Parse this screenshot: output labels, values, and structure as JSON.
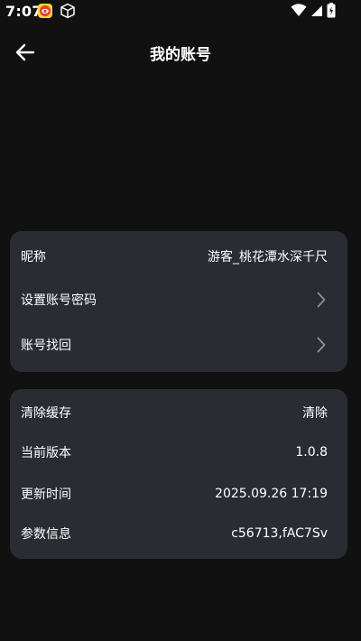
{
  "status_bar": {
    "time": "7:07"
  },
  "header": {
    "title": "我的账号"
  },
  "account_card": {
    "nickname_label": "昵称",
    "nickname_value": "游客_桃花潭水深千尺",
    "set_password_label": "设置账号密码",
    "recover_account_label": "账号找回"
  },
  "info_card": {
    "clear_cache_label": "清除缓存",
    "clear_cache_action": "清除",
    "version_label": "当前版本",
    "version_value": "1.0.8",
    "update_time_label": "更新时间",
    "update_time_value": "2025.09.26 17:19",
    "params_label": "参数信息",
    "params_value": "c56713,fAC7Sv"
  },
  "colors": {
    "background": "#111112",
    "card": "#2a2c34",
    "text": "#ffffff",
    "chevron": "#8e9099"
  }
}
